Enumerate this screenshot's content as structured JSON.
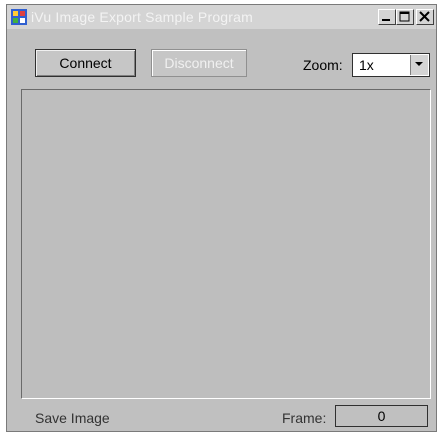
{
  "window": {
    "title": "iVu Image Export Sample Program"
  },
  "toolbar": {
    "connect_label": "Connect",
    "disconnect_label": "Disconnect",
    "zoom_label": "Zoom:",
    "zoom_value": "1x"
  },
  "status": {
    "save_label": "Save Image",
    "frame_label": "Frame:",
    "frame_value": "0"
  },
  "icons": {
    "app": "app-icon",
    "minimize": "minimize-icon",
    "maximize": "maximize-icon",
    "close": "close-icon",
    "dropdown": "chevron-down-icon"
  }
}
